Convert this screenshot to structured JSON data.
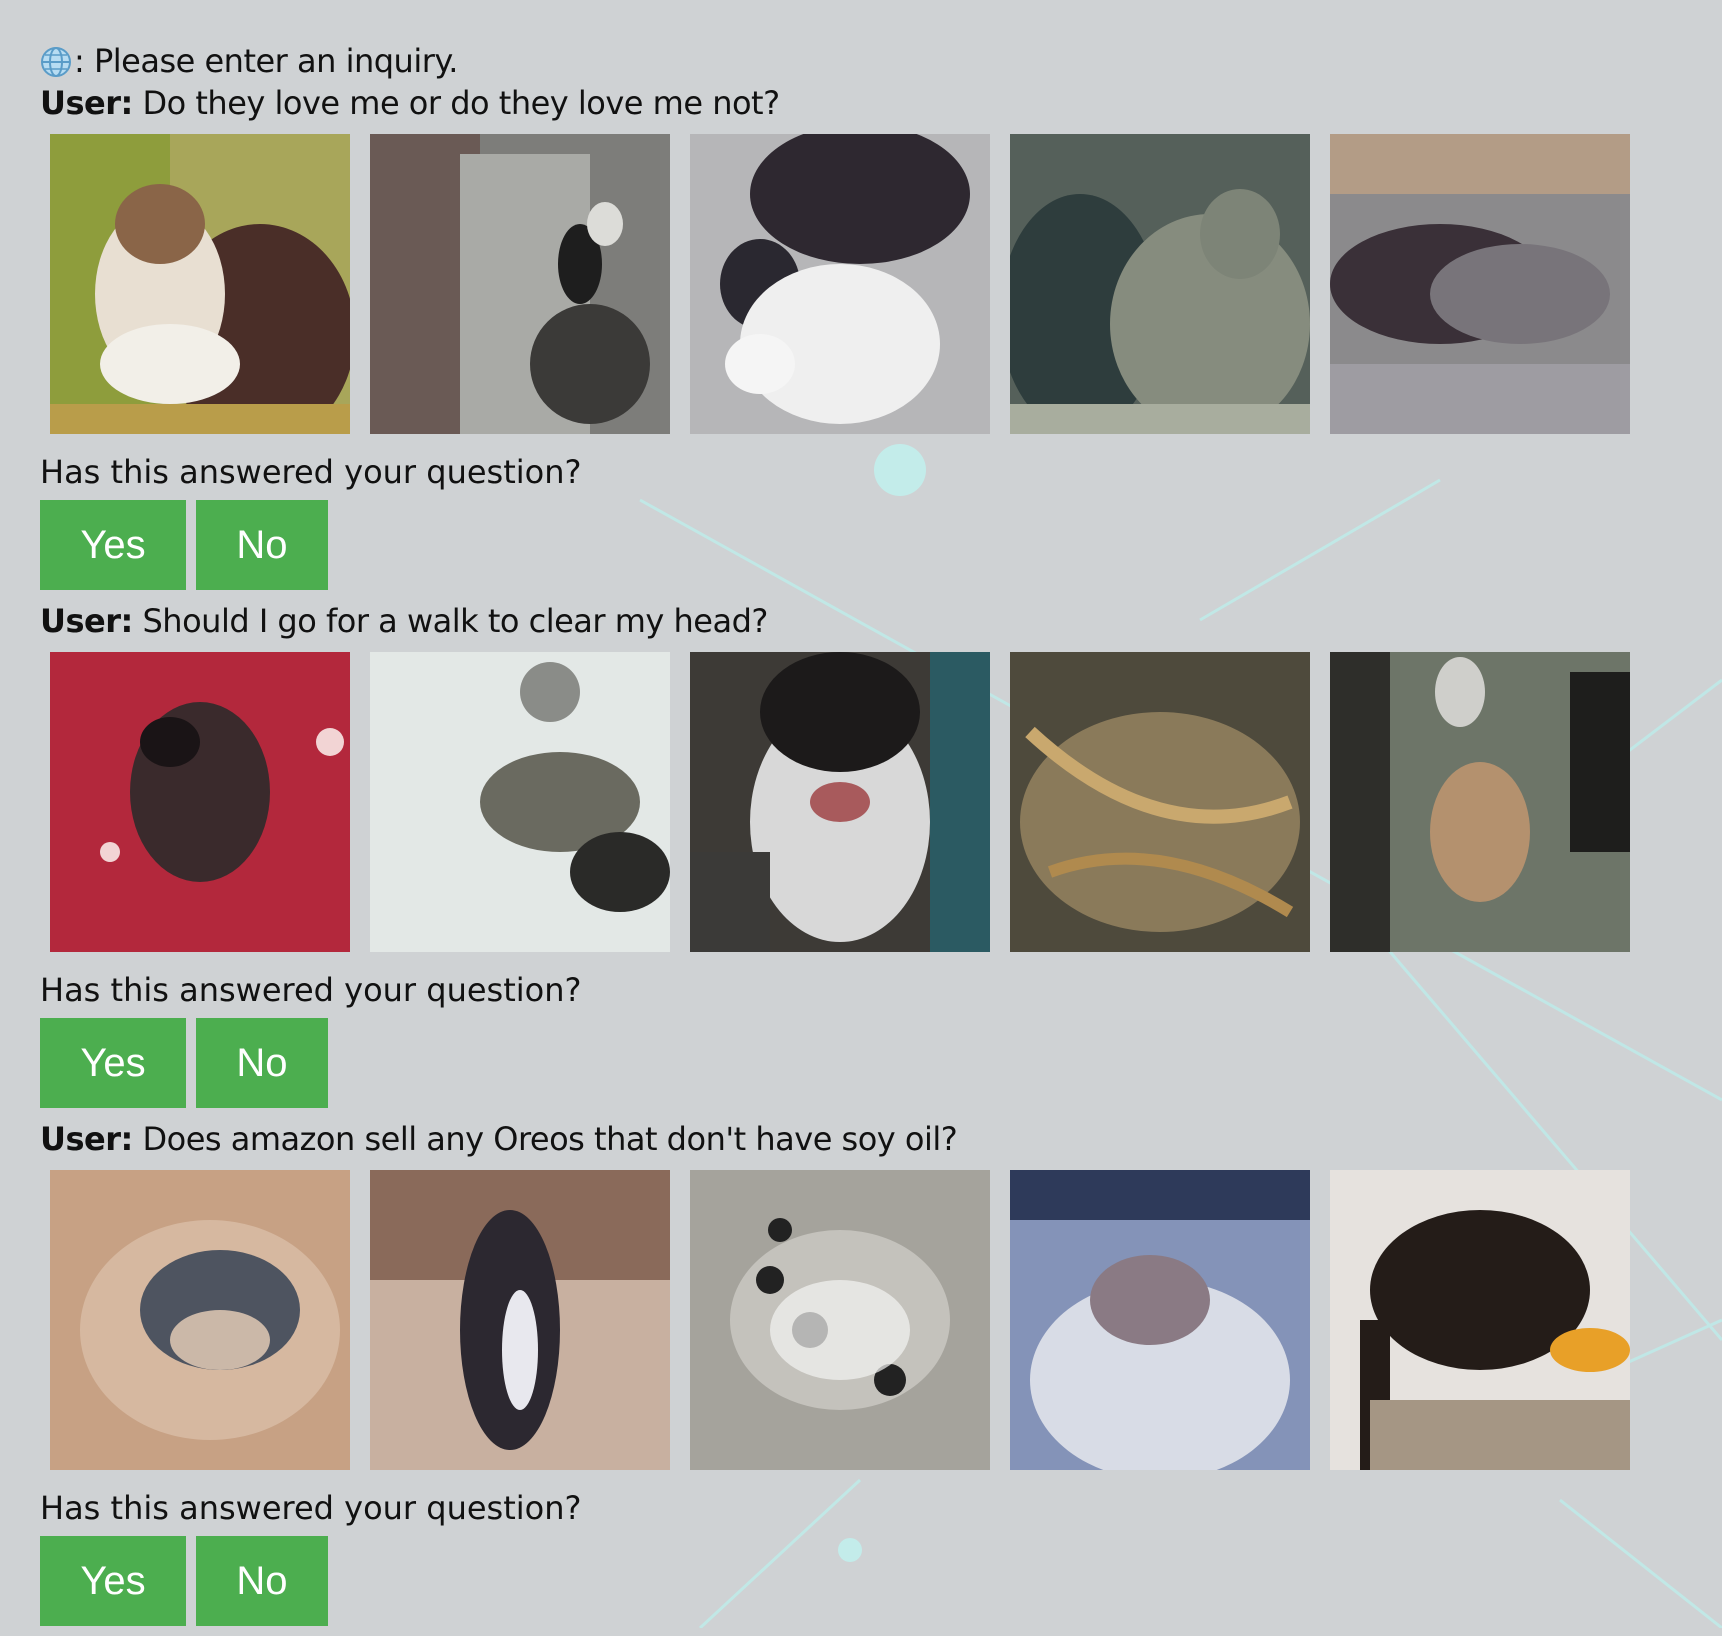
{
  "system_prompt": {
    "icon": "globe-icon",
    "text": ": Please enter an inquiry."
  },
  "speaker_label": "User:",
  "exchanges": [
    {
      "question": "Do they love me or do they love me not?",
      "feedback_prompt": "Has this answered your question?",
      "yes_label": "Yes",
      "no_label": "No"
    },
    {
      "question": "Should I go for a walk to clear my head?",
      "feedback_prompt": "Has this answered your question?",
      "yes_label": "Yes",
      "no_label": "No"
    },
    {
      "question": "Does amazon sell any Oreos that don't have soy oil?",
      "feedback_prompt": "Has this answered your question?",
      "yes_label": "Yes",
      "no_label": "No"
    }
  ],
  "colors": {
    "button": "#4cae4f",
    "background": "#cfd2d4"
  }
}
